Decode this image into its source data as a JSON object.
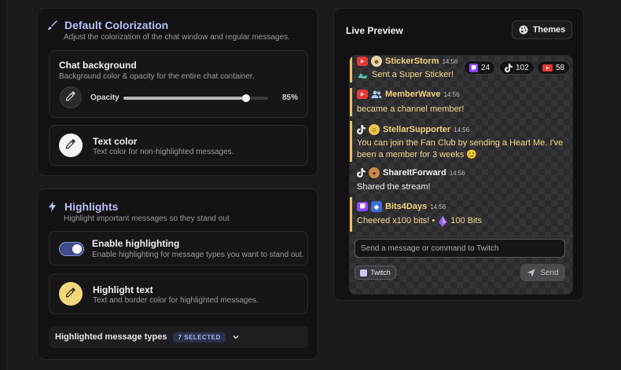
{
  "colorization": {
    "title": "Default Colorization",
    "subtitle": "Adjust the colorization of the chat window and regular messages.",
    "chat_background": {
      "title": "Chat background",
      "subtitle": "Background color & opacity for the entire chat container.",
      "opacity_label": "Opacity",
      "opacity_value": "85%",
      "opacity_fraction": 0.85
    },
    "text_color": {
      "title": "Text color",
      "subtitle": "Text color for non-highlighted messages."
    }
  },
  "highlights": {
    "title": "Highlights",
    "subtitle": "Highlight important messages so they stand out",
    "enable": {
      "title": "Enable highlighting",
      "subtitle": "Enable highlighting for message types you want to stand out.",
      "on": true
    },
    "highlight_text": {
      "title": "Highlight text",
      "subtitle": "Text and border color for highlighted messages."
    },
    "types": {
      "label": "Highlighted message types",
      "badge": "7 SELECTED"
    }
  },
  "preview": {
    "title": "Live Preview",
    "themes_label": "Themes",
    "counters": [
      {
        "icon": "twitch-icon",
        "value": "24"
      },
      {
        "icon": "tiktok-icon",
        "value": "102"
      },
      {
        "icon": "youtube-icon",
        "value": "58"
      }
    ],
    "messages": [
      {
        "platform": "youtube",
        "user": "StickerStorm",
        "time": "14:56",
        "text": "Sent a Super Sticker!",
        "highlighted": true
      },
      {
        "platform": "youtube",
        "user": "MemberWave",
        "time": "14:56",
        "text": "became a channel member!",
        "highlighted": true
      },
      {
        "platform": "tiktok",
        "user": "StellarSupporter",
        "time": "14:56",
        "text": "You can join the Fan Club by sending a Heart Me. I've been a member for 3 weeks 😊",
        "highlighted": true
      },
      {
        "platform": "tiktok",
        "user": "ShareItForward",
        "time": "14:56",
        "text": "Shared the stream!",
        "highlighted": false
      },
      {
        "platform": "twitch",
        "user": "Bits4Days",
        "time": "14:56",
        "text": "Cheered x100 bits!  •",
        "bits": "100 Bits",
        "highlighted": true
      }
    ],
    "input_placeholder": "Send a message or command to Twitch",
    "platform_button": "Twitch",
    "send_label": "Send"
  },
  "colors": {
    "accent": "#b9bdf7",
    "highlight": "#f0d27a",
    "highlight_border": "#e8c35c",
    "youtube": "#e53935",
    "twitch": "#9146ff"
  }
}
